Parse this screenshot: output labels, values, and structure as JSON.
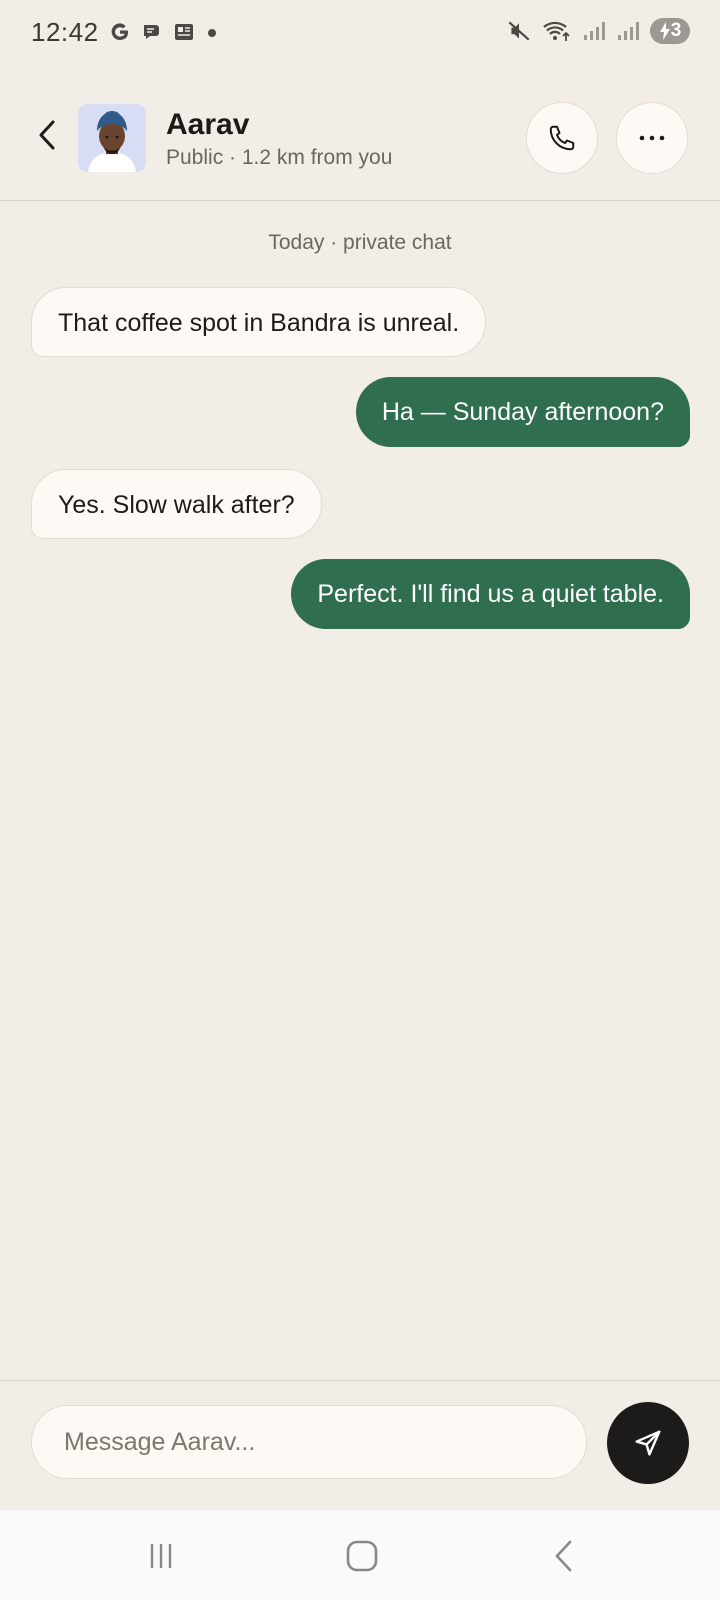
{
  "status_bar": {
    "time": "12:42",
    "battery_level": "3",
    "left_icons": [
      "google-icon",
      "chat-bubble-icon",
      "news-icon",
      "dot-icon"
    ],
    "right_icons": [
      "mute-icon",
      "wifi-icon",
      "signal-icon",
      "signal-icon"
    ]
  },
  "header": {
    "name": "Aarav",
    "subtitle": "Public · 1.2 km from you"
  },
  "chat": {
    "day_separator": "Today · private chat",
    "messages": [
      {
        "direction": "incoming",
        "text": "That coffee spot in Bandra is unreal."
      },
      {
        "direction": "outgoing",
        "text": "Ha — Sunday afternoon?"
      },
      {
        "direction": "incoming",
        "text": "Yes. Slow walk after?"
      },
      {
        "direction": "outgoing",
        "text": "Perfect. I'll find us a quiet table."
      }
    ]
  },
  "composer": {
    "placeholder": "Message Aarav...",
    "value": ""
  },
  "colors": {
    "background": "#f3ede7",
    "outgoing_bubble": "#2f6e4e",
    "incoming_bubble": "#fdfaf6",
    "send_button": "#1c1b19"
  }
}
